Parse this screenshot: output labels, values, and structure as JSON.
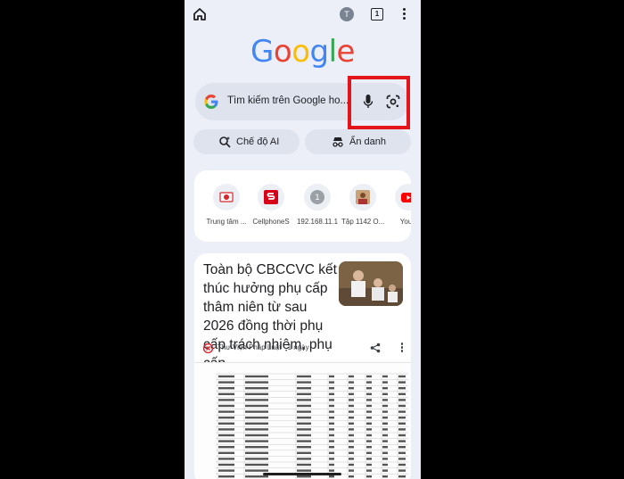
{
  "topbar": {
    "avatar_letter": "T",
    "tab_count": "1"
  },
  "logo": {
    "letters": [
      "G",
      "o",
      "o",
      "g",
      "l",
      "e"
    ],
    "colors": [
      "#4285F4",
      "#EA4335",
      "#FBBC05",
      "#4285F4",
      "#34A853",
      "#EA4335"
    ]
  },
  "search": {
    "placeholder": "Tìm kiếm trên Google ho..."
  },
  "pills": {
    "ai_label": "Chế độ AI",
    "incognito_label": "Ẩn danh"
  },
  "shortcuts": [
    {
      "label": "Trung tâm ...",
      "icon": "thegioididong-icon"
    },
    {
      "label": "CellphoneS",
      "icon": "cellphones-icon"
    },
    {
      "label": "192.168.11.1",
      "icon": "letter-1-icon"
    },
    {
      "label": "Tập 1142 O...",
      "icon": "video-thumb-icon"
    },
    {
      "label": "YouT",
      "icon": "youtube-icon"
    }
  ],
  "shortcut_letter": "1",
  "news": {
    "headline": "Toàn bộ CBCCVC kết thúc hưởng phụ cấp thâm niên từ sau 2026 đồng thời phụ cấp trách nhiệm, phụ cấp...",
    "source": "Thư Viện Pháp Luật · 1 ngày"
  },
  "accent_colors": {
    "highlight": "#e3141a",
    "background": "#eceff7"
  }
}
